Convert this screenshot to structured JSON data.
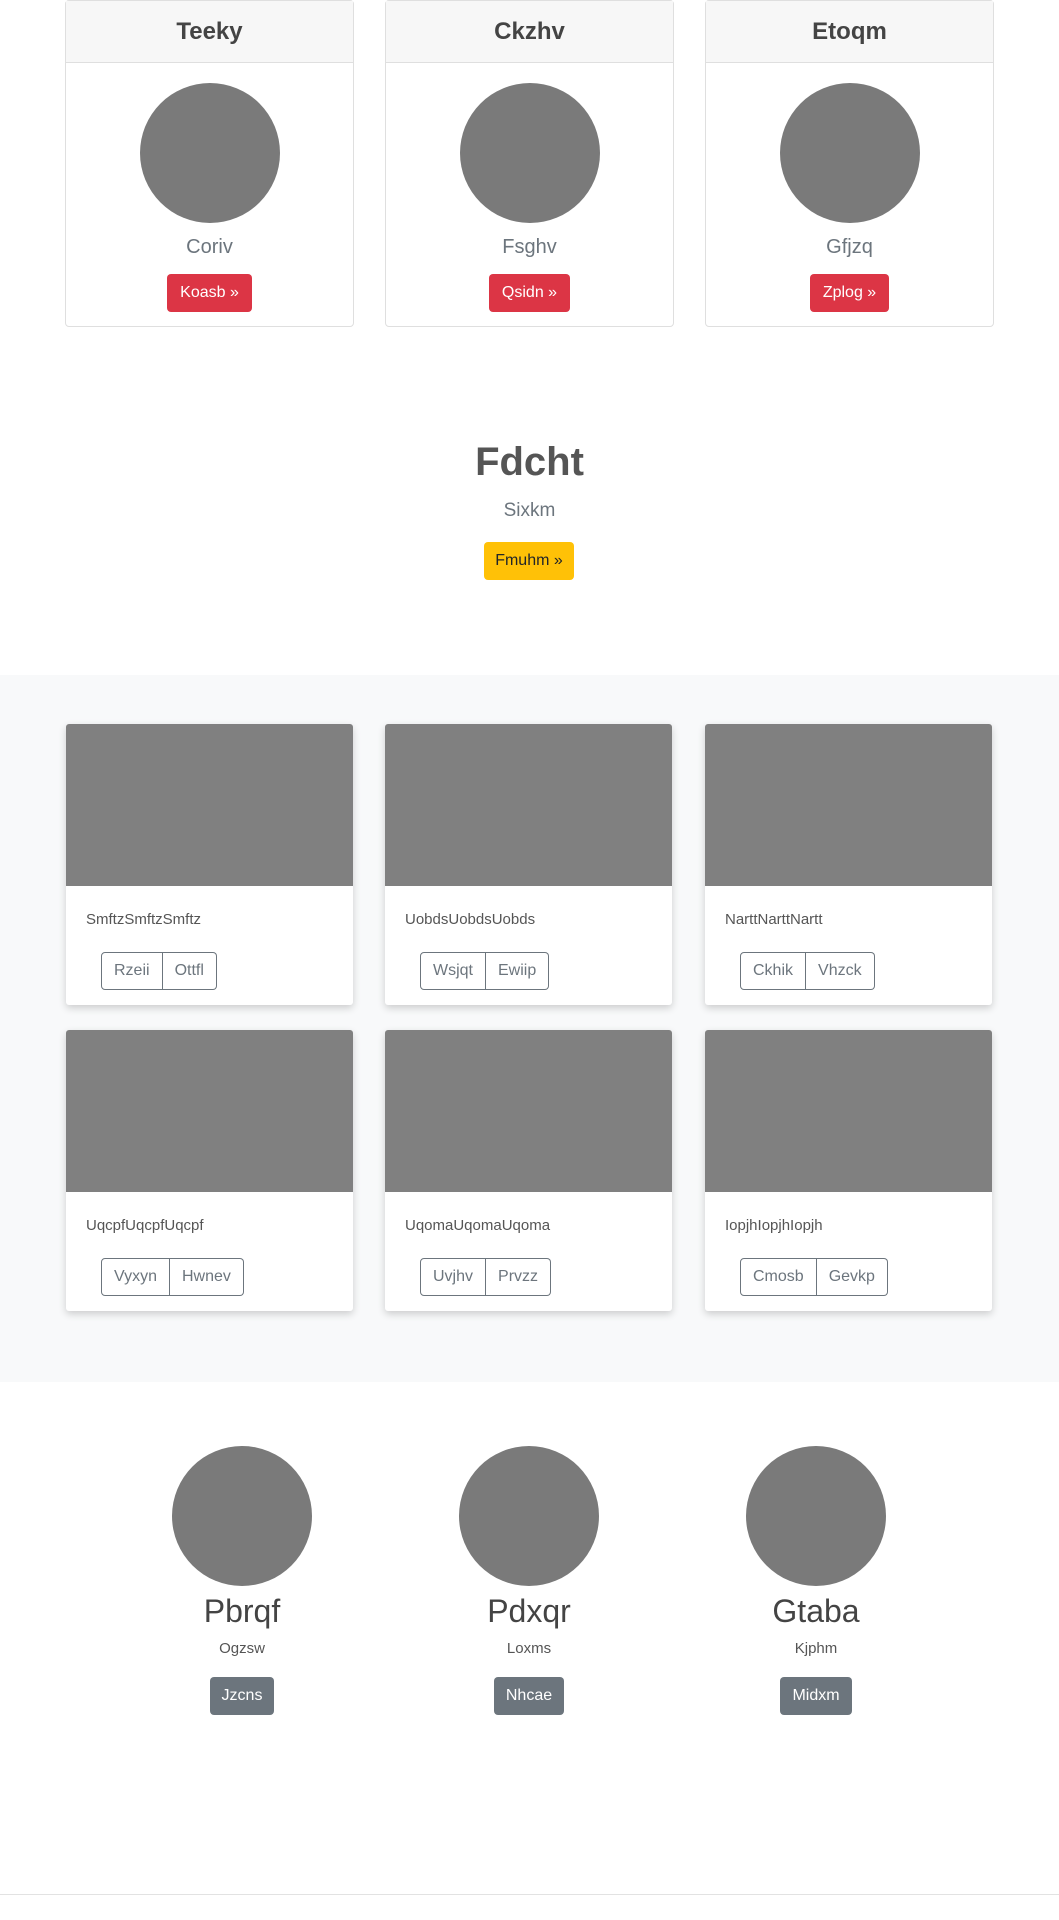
{
  "top_cards": [
    {
      "title": "Teeky",
      "subtitle": "Coriv",
      "button": "Koasb »"
    },
    {
      "title": "Ckzhv",
      "subtitle": "Fsghv",
      "button": "Qsidn »"
    },
    {
      "title": "Etoqm",
      "subtitle": "Gfjzq",
      "button": "Zplog »"
    }
  ],
  "hero": {
    "title": "Fdcht",
    "subtitle": "Sixkm",
    "button": "Fmuhm »"
  },
  "album": [
    {
      "text": "SmftzSmftzSmftz",
      "btn1": "Rzeii",
      "btn2": "Ottfl"
    },
    {
      "text": "UobdsUobdsUobds",
      "btn1": "Wsjqt",
      "btn2": "Ewiip"
    },
    {
      "text": "NarttNarttNartt",
      "btn1": "Ckhik",
      "btn2": "Vhzck"
    },
    {
      "text": "UqcpfUqcpfUqcpf",
      "btn1": "Vyxyn",
      "btn2": "Hwnev"
    },
    {
      "text": "UqomaUqomaUqoma",
      "btn1": "Uvjhv",
      "btn2": "Prvzz"
    },
    {
      "text": "IopjhIopjhIopjh",
      "btn1": "Cmosb",
      "btn2": "Gevkp"
    }
  ],
  "team": [
    {
      "name": "Pbrqf",
      "role": "Ogzsw",
      "button": "Jzcns"
    },
    {
      "name": "Pdxqr",
      "role": "Loxms",
      "button": "Nhcae"
    },
    {
      "name": "Gtaba",
      "role": "Kjphm",
      "button": "Midxm"
    }
  ],
  "colors": {
    "danger": "#dc3545",
    "warning": "#ffc107",
    "secondary": "#6c757d",
    "placeholder": "#808080",
    "section_bg": "#f8f9fa"
  }
}
